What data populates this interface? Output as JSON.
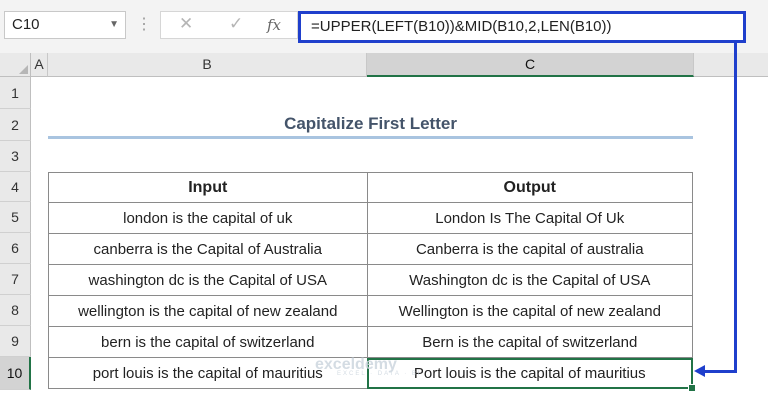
{
  "formula_bar": {
    "name_box": "C10",
    "cancel_icon": "✕",
    "enter_icon": "✓",
    "fx_label": "fx",
    "formula": "=UPPER(LEFT(B10))&MID(B10,2,LEN(B10))"
  },
  "columns": [
    "A",
    "B",
    "C"
  ],
  "rows": [
    "1",
    "2",
    "3",
    "4",
    "5",
    "6",
    "7",
    "8",
    "9",
    "10"
  ],
  "title": "Capitalize First Letter",
  "table": {
    "headers": [
      "Input",
      "Output"
    ],
    "rows": [
      {
        "input": "london is the capital of uk",
        "output": "London Is The Capital Of Uk"
      },
      {
        "input": "canberra is the Capital of Australia",
        "output": "Canberra is the capital of australia"
      },
      {
        "input": "washington dc is the Capital of USA",
        "output": "Washington dc is the Capital of USA"
      },
      {
        "input": "wellington is the capital of new zealand",
        "output": "Wellington is the capital of new zealand"
      },
      {
        "input": "bern is the capital of switzerland",
        "output": "Bern is the capital of switzerland"
      },
      {
        "input": "port louis is the capital of mauritius",
        "output": "Port louis is the capital of mauritius"
      }
    ]
  },
  "watermark": {
    "name": "exceldemy",
    "tagline": "EXCEL · DATA · BI"
  },
  "colors": {
    "accent": "#1f3fcc",
    "excel_green": "#217346",
    "title_underline": "#a9c4e0"
  }
}
